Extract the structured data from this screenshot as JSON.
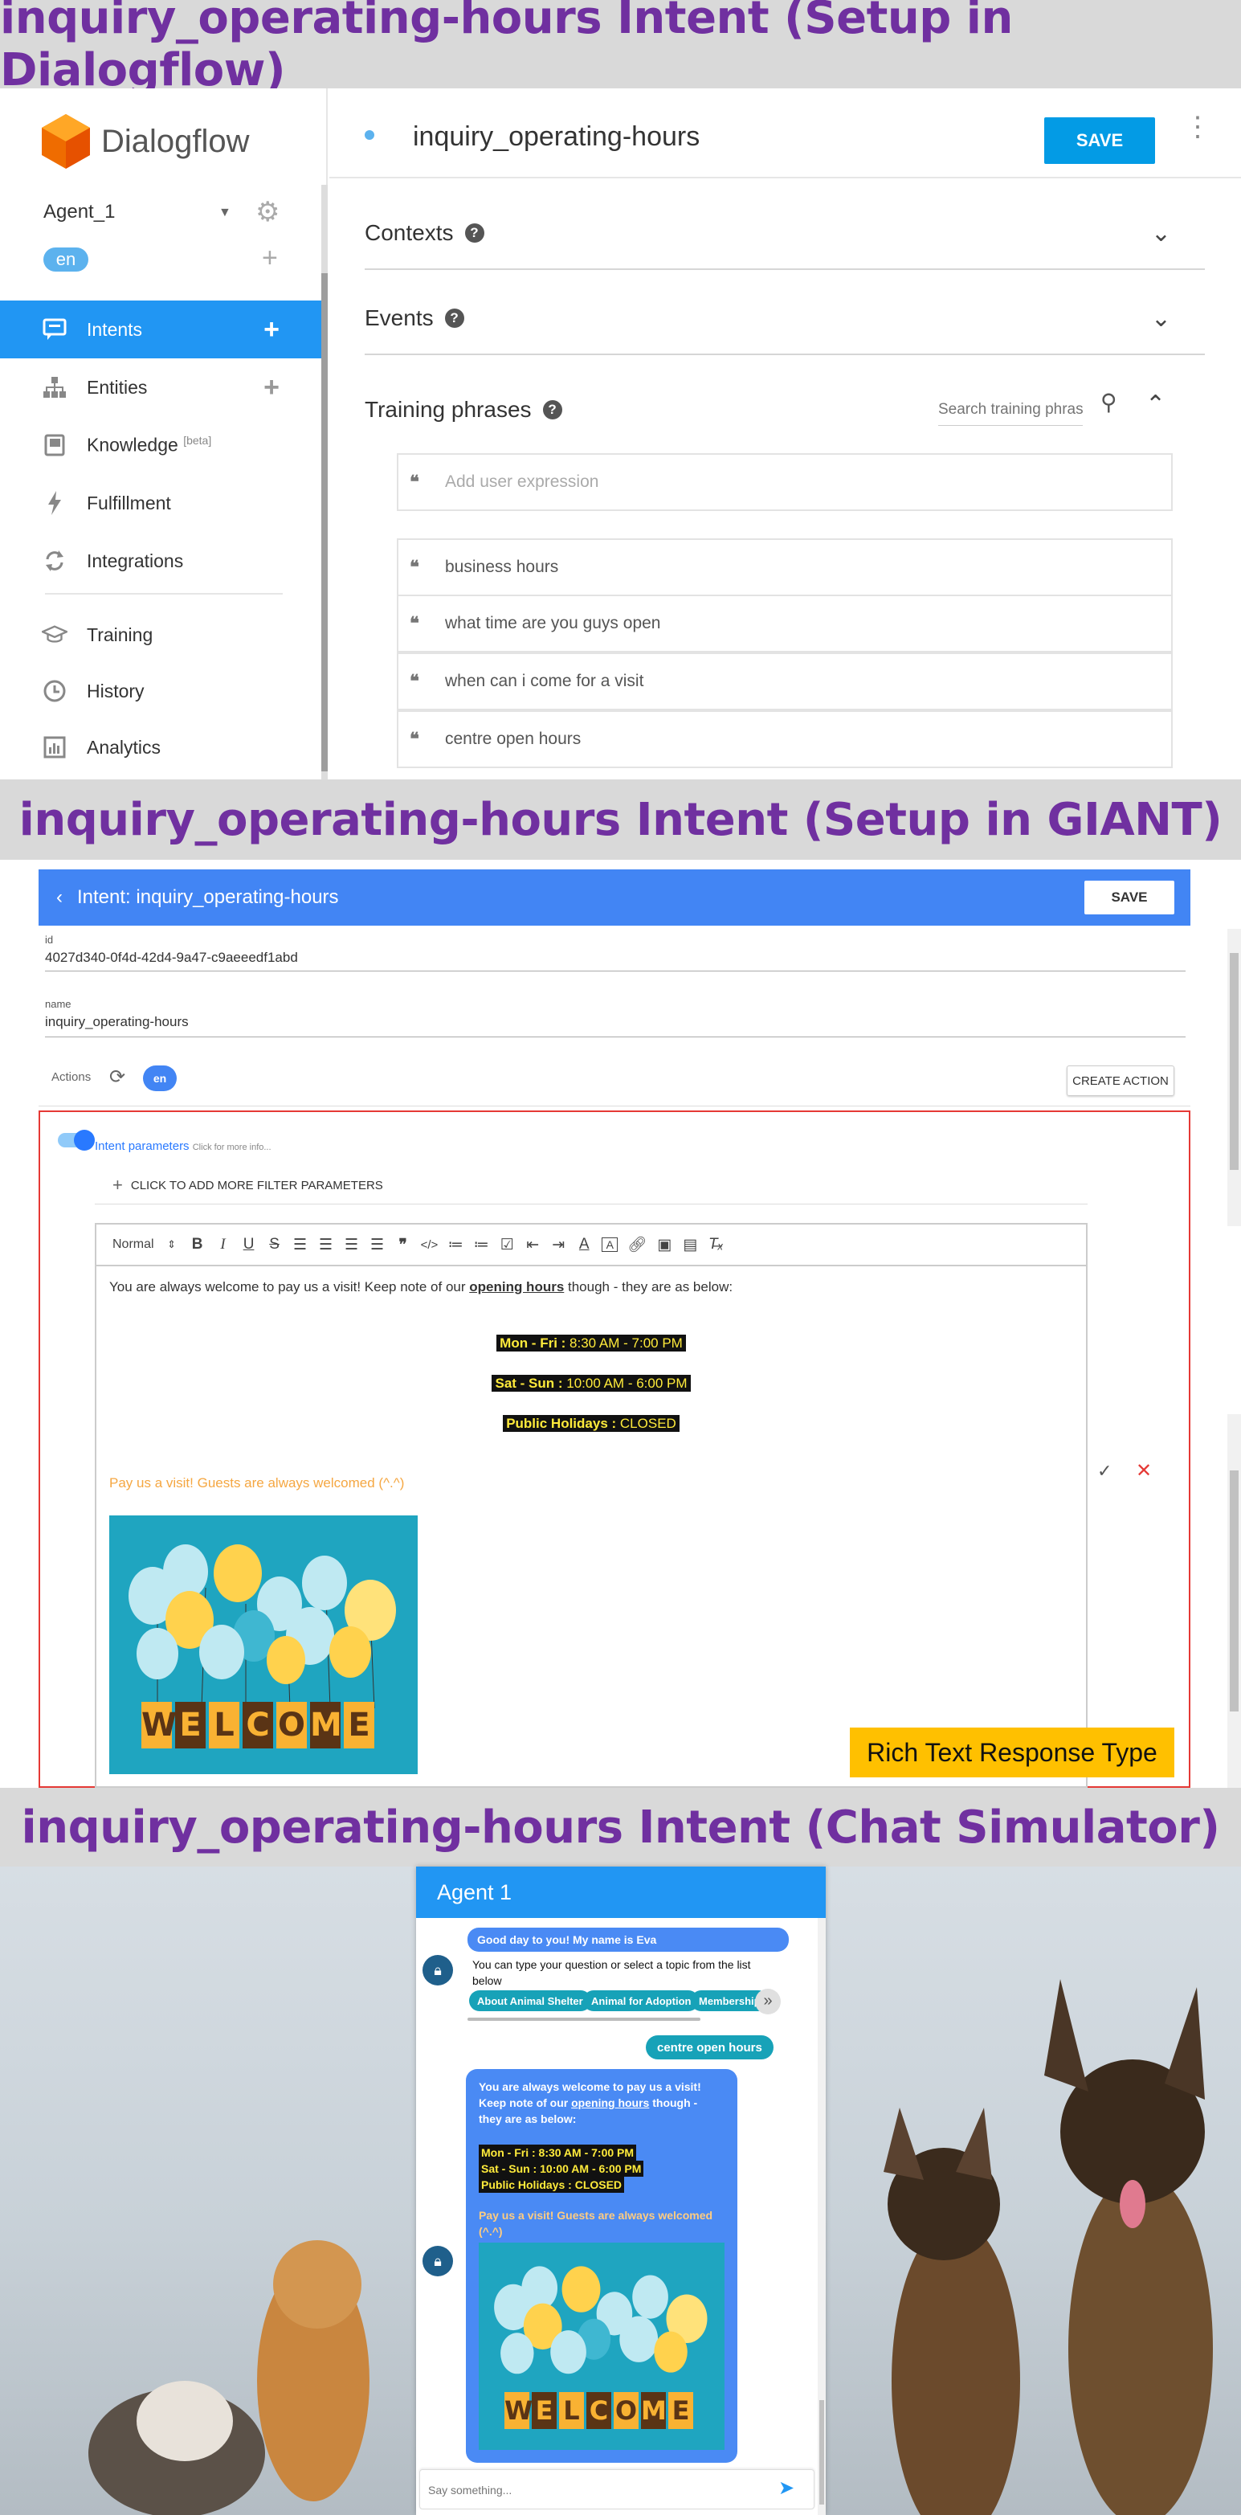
{
  "banners": {
    "dialogflow": "inquiry_operating-hours Intent (Setup in Dialogflow)",
    "giant": "inquiry_operating-hours Intent (Setup in GIANT)",
    "simulator": "inquiry_operating-hours Intent (Chat Simulator)"
  },
  "dialogflow": {
    "logo_text": "Dialogflow",
    "agent": "Agent_1",
    "language": "en",
    "nav": [
      {
        "label": "Intents",
        "icon": "chat-icon"
      },
      {
        "label": "Entities",
        "icon": "sitemap-icon"
      },
      {
        "label": "Knowledge",
        "badge": "[beta]",
        "icon": "book-icon"
      },
      {
        "label": "Fulfillment",
        "icon": "bolt-icon"
      },
      {
        "label": "Integrations",
        "icon": "sync-icon"
      },
      {
        "label": "Training",
        "icon": "graduation-cap-icon"
      },
      {
        "label": "History",
        "icon": "clock-icon"
      },
      {
        "label": "Analytics",
        "icon": "bar-chart-icon"
      }
    ],
    "intent_name": "inquiry_operating-hours",
    "save": "SAVE",
    "sections": {
      "contexts": "Contexts",
      "events": "Events",
      "training": "Training phrases"
    },
    "search_placeholder": "Search training phrases",
    "add_expression_placeholder": "Add user expression",
    "phrases": [
      "business hours",
      "what time are you guys open",
      "when can i come for a visit",
      "centre open hours"
    ]
  },
  "giant": {
    "title": "Intent: inquiry_operating-hours",
    "save": "SAVE",
    "id_label": "id",
    "id_value": "4027d340-0f4d-42d4-9a47-c9aeeedf1abd",
    "name_label": "name",
    "name_value": "inquiry_operating-hours",
    "actions_label": "Actions",
    "lang": "en",
    "create_action": "CREATE ACTION",
    "intent_params": "Intent parameters",
    "more_info": "Click for more info...",
    "add_filter": "CLICK TO ADD MORE FILTER PARAMETERS",
    "toolbar_format": "Normal",
    "intro_pre": "You are always welcome to pay us a visit! Keep note of our ",
    "intro_link": "opening hours",
    "intro_post": " though - they are as below:",
    "hours": [
      {
        "day": "Mon - Fri :",
        "time": " 8:30 AM - 7:00 PM"
      },
      {
        "day": "Sat - Sun :",
        "time": " 10:00 AM - 6:00 PM"
      },
      {
        "day": "Public Holidays :",
        "time": " CLOSED"
      }
    ],
    "closing_line": "Pay us a visit! Guests are always welcomed (^.^)",
    "welcome_letters": [
      "W",
      "E",
      "L",
      "C",
      "O",
      "M",
      "E"
    ],
    "rich_label": "Rich Text Response Type"
  },
  "simulator": {
    "title": "Agent 1",
    "greeting": "Good day to you! My name is Eva",
    "prompt": "You can type your question or select a topic from the list below",
    "chips": [
      "About Animal Shelter",
      "Animal for Adoption",
      "Membership"
    ],
    "user_message": "centre open hours",
    "reply_pre": "You are always welcome to pay us a visit! Keep note of our ",
    "reply_link": "opening hours",
    "reply_post": " though - they are as below:",
    "hours": [
      {
        "day": "Mon - Fri :",
        "time": " 8:30 AM - 7:00 PM"
      },
      {
        "day": "Sat - Sun :",
        "time": " 10:00 AM - 6:00 PM"
      },
      {
        "day": "Public Holidays :",
        "time": " CLOSED"
      }
    ],
    "closing_line": "Pay us a visit! Guests are always welcomed (^.^)",
    "input_placeholder": "Say something..."
  },
  "colors": {
    "banner_text": "#7030a0",
    "dialogflow_blue": "#2196f3",
    "giant_blue": "#4285f4",
    "highlight": "#ffeb3b",
    "rich_label": "#ffc000",
    "closing_orange": "#f5a742"
  }
}
